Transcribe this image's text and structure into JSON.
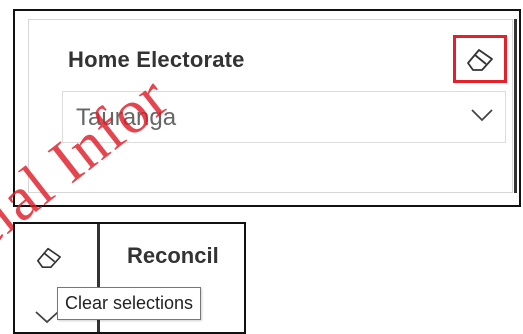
{
  "top_slicer": {
    "title": "Home Electorate",
    "selected_value": "Tauranga",
    "clear_icon": "eraser-icon",
    "dropdown_icon": "chevron-down-icon",
    "highlight_color": "#e4202a"
  },
  "watermark": {
    "text": "cial Infor",
    "color": "#df1c28"
  },
  "bottom_crop": {
    "title": "Reconcil",
    "clear_icon": "eraser-icon",
    "dropdown_icon": "chevron-down-icon",
    "tooltip": "Clear selections"
  }
}
